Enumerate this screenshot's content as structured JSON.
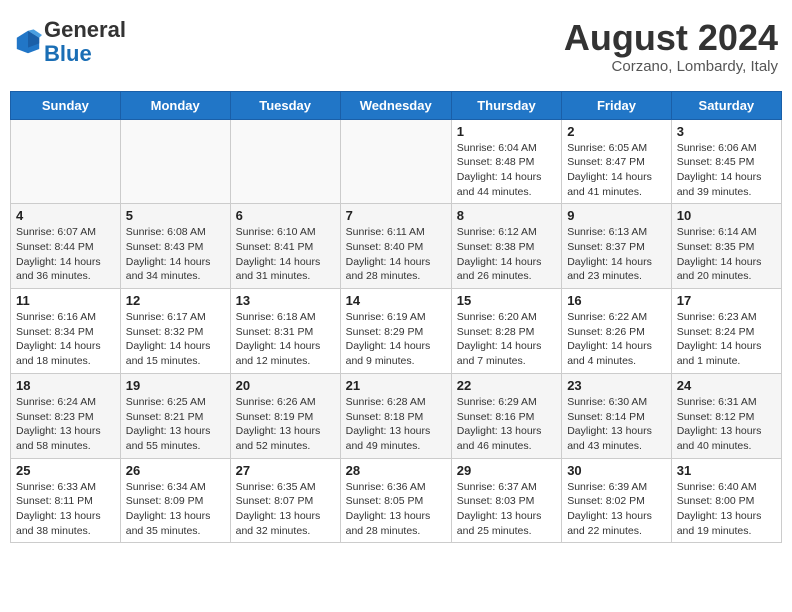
{
  "header": {
    "logo_line1": "General",
    "logo_line2": "Blue",
    "month_title": "August 2024",
    "subtitle": "Corzano, Lombardy, Italy"
  },
  "days_of_week": [
    "Sunday",
    "Monday",
    "Tuesday",
    "Wednesday",
    "Thursday",
    "Friday",
    "Saturday"
  ],
  "weeks": [
    [
      {
        "day": "",
        "info": ""
      },
      {
        "day": "",
        "info": ""
      },
      {
        "day": "",
        "info": ""
      },
      {
        "day": "",
        "info": ""
      },
      {
        "day": "1",
        "info": "Sunrise: 6:04 AM\nSunset: 8:48 PM\nDaylight: 14 hours\nand 44 minutes."
      },
      {
        "day": "2",
        "info": "Sunrise: 6:05 AM\nSunset: 8:47 PM\nDaylight: 14 hours\nand 41 minutes."
      },
      {
        "day": "3",
        "info": "Sunrise: 6:06 AM\nSunset: 8:45 PM\nDaylight: 14 hours\nand 39 minutes."
      }
    ],
    [
      {
        "day": "4",
        "info": "Sunrise: 6:07 AM\nSunset: 8:44 PM\nDaylight: 14 hours\nand 36 minutes."
      },
      {
        "day": "5",
        "info": "Sunrise: 6:08 AM\nSunset: 8:43 PM\nDaylight: 14 hours\nand 34 minutes."
      },
      {
        "day": "6",
        "info": "Sunrise: 6:10 AM\nSunset: 8:41 PM\nDaylight: 14 hours\nand 31 minutes."
      },
      {
        "day": "7",
        "info": "Sunrise: 6:11 AM\nSunset: 8:40 PM\nDaylight: 14 hours\nand 28 minutes."
      },
      {
        "day": "8",
        "info": "Sunrise: 6:12 AM\nSunset: 8:38 PM\nDaylight: 14 hours\nand 26 minutes."
      },
      {
        "day": "9",
        "info": "Sunrise: 6:13 AM\nSunset: 8:37 PM\nDaylight: 14 hours\nand 23 minutes."
      },
      {
        "day": "10",
        "info": "Sunrise: 6:14 AM\nSunset: 8:35 PM\nDaylight: 14 hours\nand 20 minutes."
      }
    ],
    [
      {
        "day": "11",
        "info": "Sunrise: 6:16 AM\nSunset: 8:34 PM\nDaylight: 14 hours\nand 18 minutes."
      },
      {
        "day": "12",
        "info": "Sunrise: 6:17 AM\nSunset: 8:32 PM\nDaylight: 14 hours\nand 15 minutes."
      },
      {
        "day": "13",
        "info": "Sunrise: 6:18 AM\nSunset: 8:31 PM\nDaylight: 14 hours\nand 12 minutes."
      },
      {
        "day": "14",
        "info": "Sunrise: 6:19 AM\nSunset: 8:29 PM\nDaylight: 14 hours\nand 9 minutes."
      },
      {
        "day": "15",
        "info": "Sunrise: 6:20 AM\nSunset: 8:28 PM\nDaylight: 14 hours\nand 7 minutes."
      },
      {
        "day": "16",
        "info": "Sunrise: 6:22 AM\nSunset: 8:26 PM\nDaylight: 14 hours\nand 4 minutes."
      },
      {
        "day": "17",
        "info": "Sunrise: 6:23 AM\nSunset: 8:24 PM\nDaylight: 14 hours\nand 1 minute."
      }
    ],
    [
      {
        "day": "18",
        "info": "Sunrise: 6:24 AM\nSunset: 8:23 PM\nDaylight: 13 hours\nand 58 minutes."
      },
      {
        "day": "19",
        "info": "Sunrise: 6:25 AM\nSunset: 8:21 PM\nDaylight: 13 hours\nand 55 minutes."
      },
      {
        "day": "20",
        "info": "Sunrise: 6:26 AM\nSunset: 8:19 PM\nDaylight: 13 hours\nand 52 minutes."
      },
      {
        "day": "21",
        "info": "Sunrise: 6:28 AM\nSunset: 8:18 PM\nDaylight: 13 hours\nand 49 minutes."
      },
      {
        "day": "22",
        "info": "Sunrise: 6:29 AM\nSunset: 8:16 PM\nDaylight: 13 hours\nand 46 minutes."
      },
      {
        "day": "23",
        "info": "Sunrise: 6:30 AM\nSunset: 8:14 PM\nDaylight: 13 hours\nand 43 minutes."
      },
      {
        "day": "24",
        "info": "Sunrise: 6:31 AM\nSunset: 8:12 PM\nDaylight: 13 hours\nand 40 minutes."
      }
    ],
    [
      {
        "day": "25",
        "info": "Sunrise: 6:33 AM\nSunset: 8:11 PM\nDaylight: 13 hours\nand 38 minutes."
      },
      {
        "day": "26",
        "info": "Sunrise: 6:34 AM\nSunset: 8:09 PM\nDaylight: 13 hours\nand 35 minutes."
      },
      {
        "day": "27",
        "info": "Sunrise: 6:35 AM\nSunset: 8:07 PM\nDaylight: 13 hours\nand 32 minutes."
      },
      {
        "day": "28",
        "info": "Sunrise: 6:36 AM\nSunset: 8:05 PM\nDaylight: 13 hours\nand 28 minutes."
      },
      {
        "day": "29",
        "info": "Sunrise: 6:37 AM\nSunset: 8:03 PM\nDaylight: 13 hours\nand 25 minutes."
      },
      {
        "day": "30",
        "info": "Sunrise: 6:39 AM\nSunset: 8:02 PM\nDaylight: 13 hours\nand 22 minutes."
      },
      {
        "day": "31",
        "info": "Sunrise: 6:40 AM\nSunset: 8:00 PM\nDaylight: 13 hours\nand 19 minutes."
      }
    ]
  ]
}
